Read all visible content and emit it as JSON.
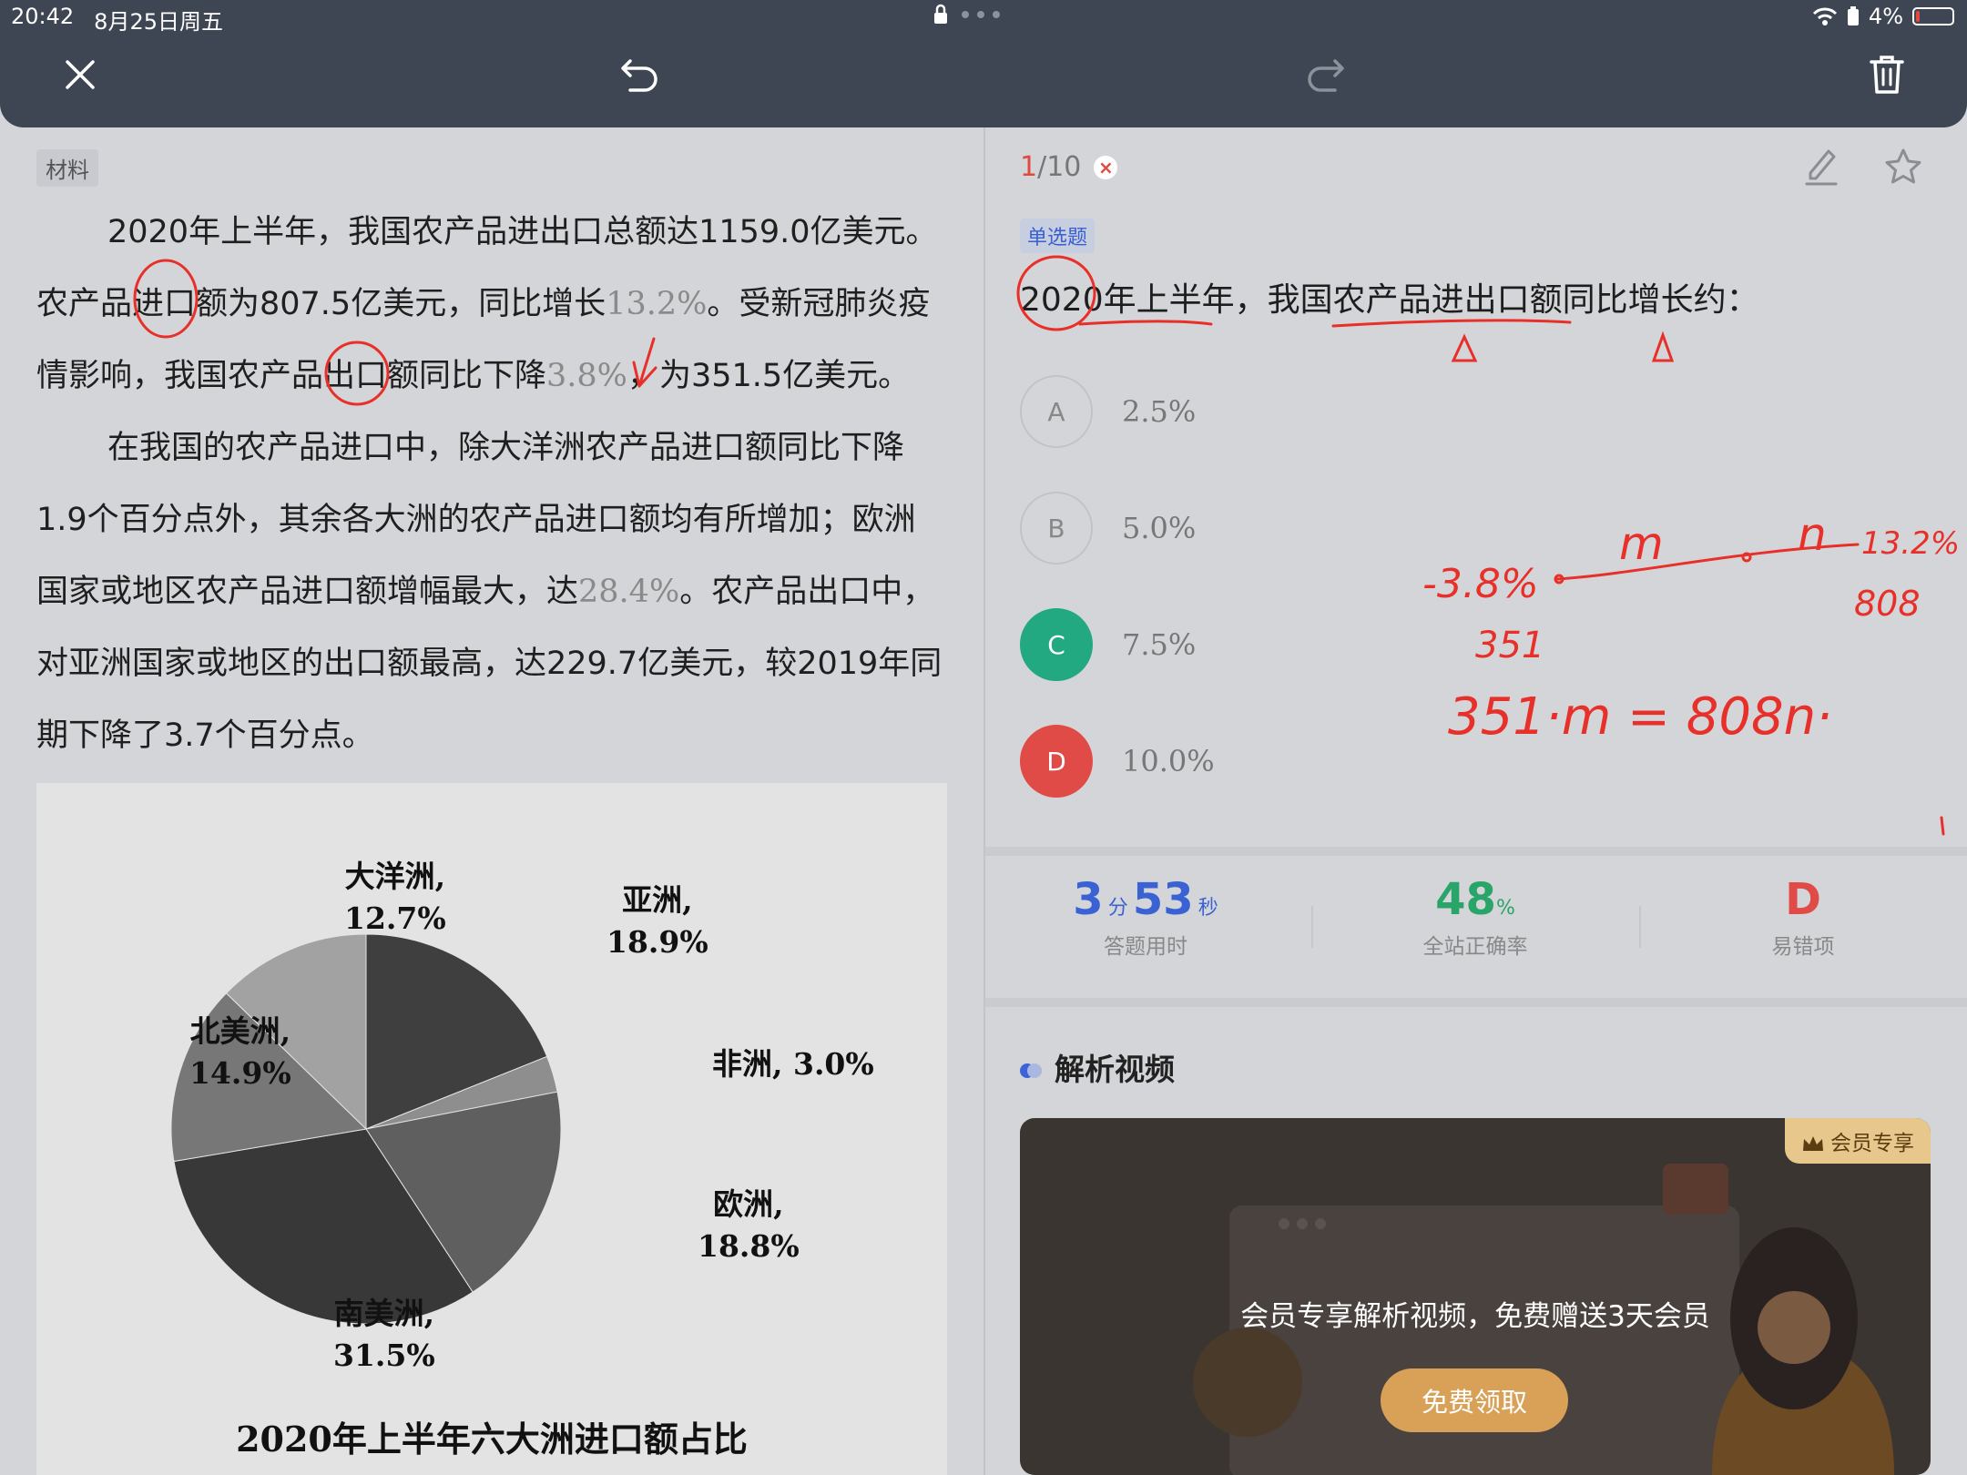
{
  "status": {
    "time": "20:42",
    "date": "8月25日周五",
    "battery": "4%"
  },
  "toolbar": {
    "close_icon": "close-icon",
    "undo_icon": "undo-icon",
    "redo_icon": "redo-icon",
    "delete_icon": "trash-icon"
  },
  "material": {
    "tag": "材料",
    "p1_l1": "2020年上半年，我国农产品进出口总额达1159.0亿美元。",
    "p1_l2a": "农产品进口额为807.5亿美元，同比增长",
    "p1_l2n": "13.2%",
    "p1_l2b": "。受新冠肺炎疫",
    "p1_l3a": "情影响，我国农产品出口额同比下降",
    "p1_l3n": "3.8%",
    "p1_l3b": "，为351.5亿美元。",
    "p2_l1": "在我国的农产品进口中，除大洋洲农产品进口额同比下降",
    "p2_l2": "1.9个百分点外，其余各大洲的农产品进口额均有所增加；欧洲",
    "p2_l3a": "国家或地区农产品进口额增幅最大，达",
    "p2_l3n": "28.4%",
    "p2_l3b": "。农产品出口中，",
    "p2_l4": "对亚洲国家或地区的出口额最高，达229.7亿美元，较2019年同",
    "p2_l5": "期下降了3.7个百分点。"
  },
  "chart_data": {
    "type": "pie",
    "title": "2020年上半年六大洲进口额占比",
    "slices": [
      {
        "label": "亚洲,",
        "value_text": "18.9%",
        "value": 18.9,
        "color": "#3f3f3f"
      },
      {
        "label": "非洲, 3.0%",
        "value_text": "",
        "value": 3.0,
        "color": "#8e8e8e"
      },
      {
        "label": "欧洲,",
        "value_text": "18.8%",
        "value": 18.8,
        "color": "#5f5f5f"
      },
      {
        "label": "南美洲,",
        "value_text": "31.5%",
        "value": 31.5,
        "color": "#383838"
      },
      {
        "label": "北美洲,",
        "value_text": "14.9%",
        "value": 14.9,
        "color": "#777777"
      },
      {
        "label": "大洋洲,",
        "value_text": "12.7%",
        "value": 12.7,
        "color": "#a2a2a2"
      }
    ]
  },
  "question": {
    "progress_current": "1",
    "progress_total": "/10",
    "wrong_mark": "×",
    "type": "单选题",
    "text": "2020年上半年，我国农产品进出口额同比增长约：",
    "options": [
      {
        "letter": "A",
        "text": "2.5%"
      },
      {
        "letter": "B",
        "text": "5.0%"
      },
      {
        "letter": "C",
        "text": "7.5%"
      },
      {
        "letter": "D",
        "text": "10.0%"
      }
    ],
    "correct_color": "#23a981",
    "wrong_color": "#e04b47"
  },
  "stats": {
    "time_min": "3",
    "time_min_unit": "分",
    "time_sec": "53",
    "time_sec_unit": "秒",
    "time_label": "答题用时",
    "accuracy": "48",
    "accuracy_unit": "%",
    "accuracy_label": "全站正确率",
    "common_wrong": "D",
    "common_wrong_label": "易错项"
  },
  "analysis": {
    "title": "解析视频",
    "vip_badge": "会员专享",
    "message": "会员专享解析视频，免费赠送3天会员",
    "button": "免费领取"
  },
  "ink": {
    "note1_left": "-3.8%",
    "note1_m": "m",
    "note1_n": "n",
    "note1_right": "13.2%",
    "note_351": "351",
    "note_808": "808",
    "equation": "351·m = 808n·"
  }
}
